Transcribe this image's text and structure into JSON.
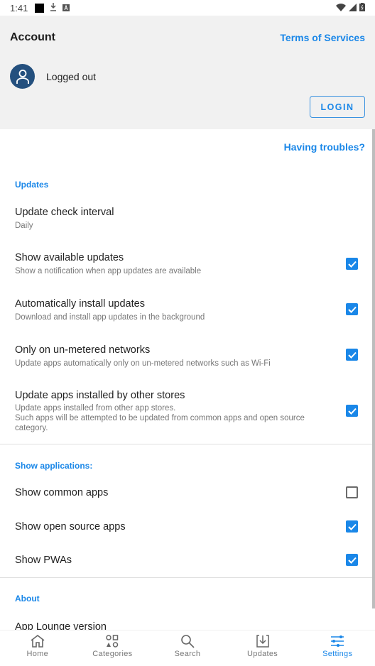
{
  "status_bar": {
    "time": "1:41",
    "icons_left": [
      "notification-square-icon",
      "download-icon",
      "a-badge-icon"
    ],
    "icons_right": [
      "wifi-icon",
      "signal-icon",
      "battery-icon"
    ]
  },
  "account": {
    "title": "Account",
    "terms_link": "Terms of Services",
    "status": "Logged out",
    "login_button": "LOGIN"
  },
  "settings": {
    "troubles_link": "Having troubles?",
    "updates_section": {
      "header": "Updates",
      "items": [
        {
          "title": "Update check interval",
          "summary": "Daily"
        },
        {
          "title": "Show available updates",
          "summary": "Show a notification when app updates are available",
          "checked": true
        },
        {
          "title": "Automatically install updates",
          "summary": "Download and install app updates in the background",
          "checked": true
        },
        {
          "title": "Only on un-metered networks",
          "summary": "Update apps automatically only on un-metered networks such as Wi-Fi",
          "checked": true
        },
        {
          "title": "Update apps installed by other stores",
          "summary": "Update apps installed from other app stores.\nSuch apps will be attempted to be updated from common apps and open source category.",
          "checked": true
        }
      ]
    },
    "apps_section": {
      "header": "Show applications:",
      "items": [
        {
          "title": "Show common apps",
          "checked": false
        },
        {
          "title": "Show open source apps",
          "checked": true
        },
        {
          "title": "Show PWAs",
          "checked": true
        }
      ]
    },
    "about_section": {
      "header": "About",
      "items": [
        {
          "title": "App Lounge version"
        }
      ]
    }
  },
  "bottom_nav": {
    "items": [
      {
        "label": "Home",
        "icon": "home-icon",
        "active": false
      },
      {
        "label": "Categories",
        "icon": "categories-icon",
        "active": false
      },
      {
        "label": "Search",
        "icon": "search-icon",
        "active": false
      },
      {
        "label": "Updates",
        "icon": "updates-icon",
        "active": false
      },
      {
        "label": "Settings",
        "icon": "settings-icon",
        "active": true
      }
    ]
  },
  "colors": {
    "accent": "#1a87e8",
    "avatar_bg": "#24507e",
    "account_bg": "#f1f1f1"
  }
}
